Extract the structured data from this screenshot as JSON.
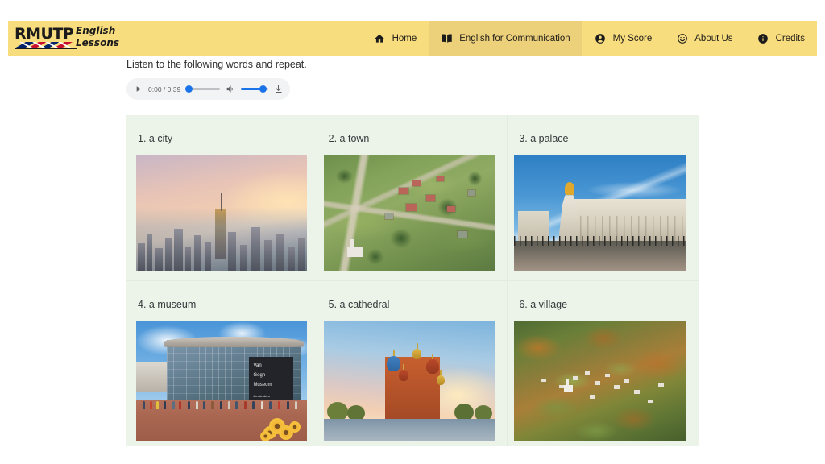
{
  "header": {
    "logo": {
      "brand": "RMUTP",
      "subtitle_line1": "English",
      "subtitle_line2": "Lessons",
      "flag_colors": [
        "#c8102e",
        "#012169",
        "#ffffff"
      ]
    },
    "background_color": "#f8dd7f",
    "active_background_color": "#ecd07a",
    "nav": [
      {
        "label": "Home",
        "icon": "home-icon",
        "active": false
      },
      {
        "label": "English for Communication",
        "icon": "book-icon",
        "active": true
      },
      {
        "label": "My Score",
        "icon": "account-circle-icon",
        "active": false
      },
      {
        "label": "About Us",
        "icon": "smiley-face-icon",
        "active": false
      },
      {
        "label": "Credits",
        "icon": "info-circle-icon",
        "active": false
      }
    ]
  },
  "main": {
    "instruction": "Listen to the following words and repeat.",
    "audio_player": {
      "play_icon": "play-icon",
      "current_time": "0:00",
      "duration": "0:39",
      "time_display": "0:00 / 0:39",
      "progress_percent": 0,
      "volume_icon": "volume-up-icon",
      "volume_percent": 75,
      "download_icon": "download-icon",
      "accent_color": "#1a73e8",
      "background_color": "#f1f3f4"
    },
    "grid_background_color": "#ecf3e9",
    "cards": [
      {
        "label": "1. a city",
        "image_alt": "city-skyline-sunset-photo"
      },
      {
        "label": "2. a town",
        "image_alt": "town-aerial-view-photo"
      },
      {
        "label": "3. a palace",
        "image_alt": "palace-victoria-memorial-photo"
      },
      {
        "label": "4. a museum",
        "image_alt": "van-gogh-museum-photo"
      },
      {
        "label": "5. a cathedral",
        "image_alt": "saint-basils-cathedral-photo"
      },
      {
        "label": "6. a village",
        "image_alt": "autumn-village-aerial-photo"
      }
    ],
    "museum_sign": {
      "line1": "Van",
      "line2": "Gogh",
      "line3": "Museum",
      "line4": "Amsterdam"
    }
  }
}
